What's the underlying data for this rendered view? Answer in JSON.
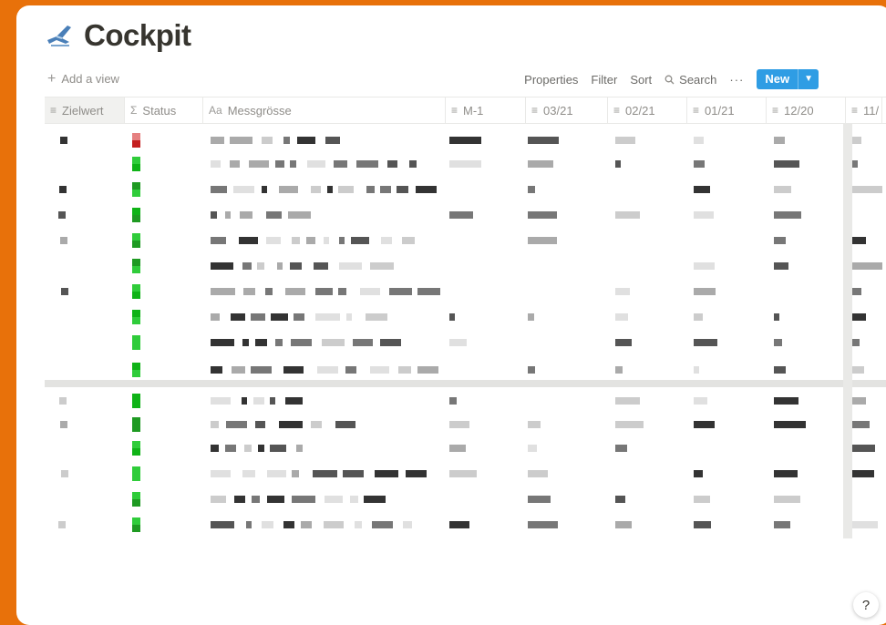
{
  "page": {
    "title": "Cockpit"
  },
  "view_bar": {
    "add_view": "Add a view"
  },
  "toolbar": {
    "properties": "Properties",
    "filter": "Filter",
    "sort": "Sort",
    "search": "Search",
    "more": "···",
    "new": "New"
  },
  "columns": [
    {
      "label": "Zielwert",
      "icon": "text-lines-icon"
    },
    {
      "label": "Status",
      "icon": "sigma-icon"
    },
    {
      "label": "Messgrösse",
      "icon": "title-icon"
    },
    {
      "label": "M-1",
      "icon": "text-lines-icon"
    },
    {
      "label": "03/21",
      "icon": "text-lines-icon"
    },
    {
      "label": "02/21",
      "icon": "text-lines-icon"
    },
    {
      "label": "01/21",
      "icon": "text-lines-icon"
    },
    {
      "label": "12/20",
      "icon": "text-lines-icon"
    },
    {
      "label": "11/",
      "icon": "text-lines-icon"
    }
  ],
  "help": {
    "label": "?"
  }
}
